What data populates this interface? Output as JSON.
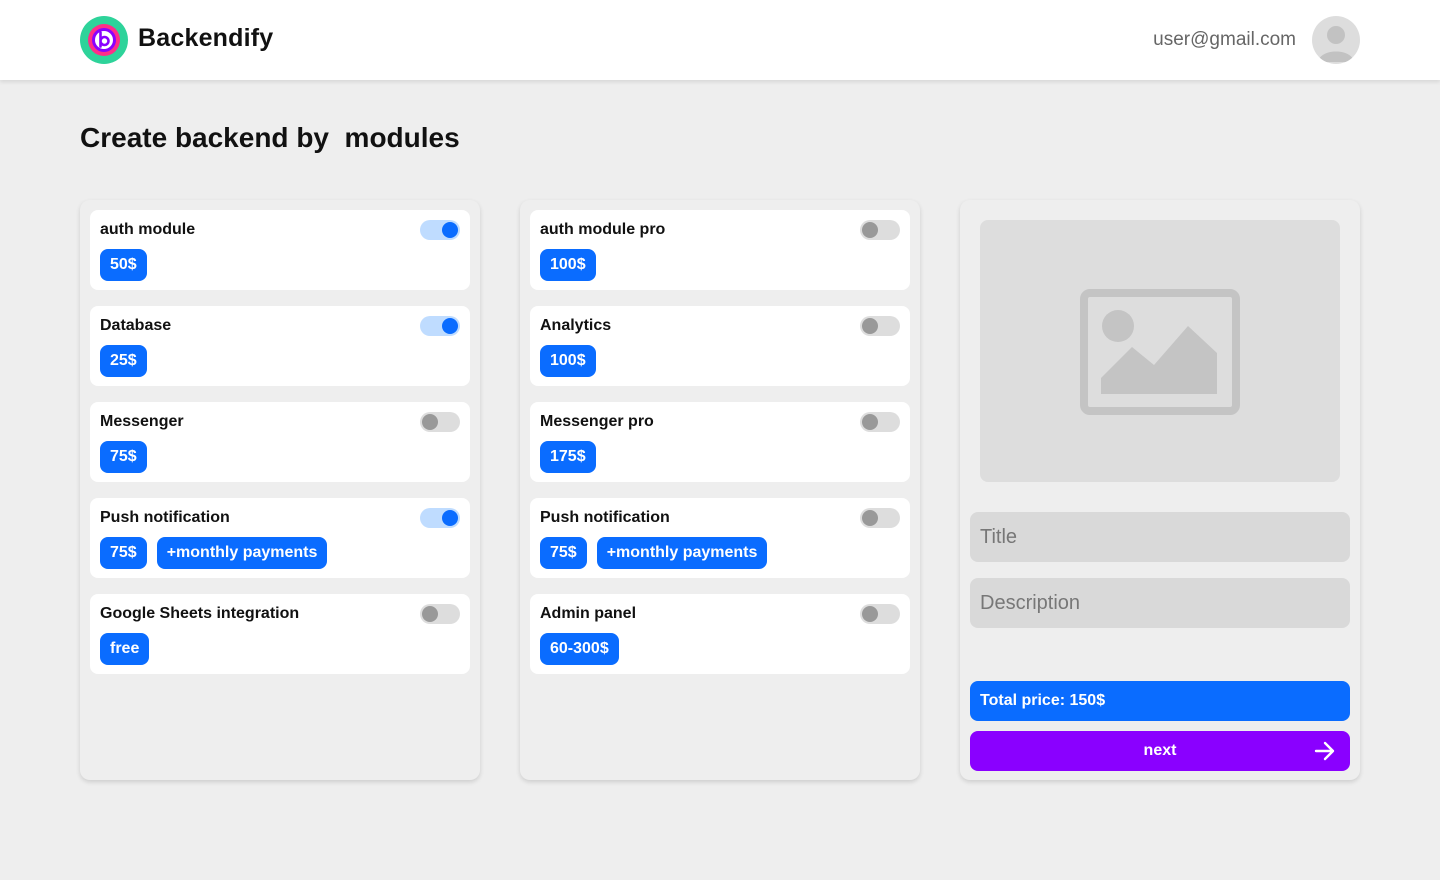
{
  "app": {
    "name": "Backendify",
    "logo_letter": "b"
  },
  "user": {
    "email": "user@gmail.com"
  },
  "page": {
    "title": "Create backend by  modules"
  },
  "columns": [
    {
      "modules": [
        {
          "name": "auth module",
          "enabled": true,
          "tags": [
            "50$"
          ]
        },
        {
          "name": "Database",
          "enabled": true,
          "tags": [
            "25$"
          ]
        },
        {
          "name": "Messenger",
          "enabled": false,
          "tags": [
            "75$"
          ]
        },
        {
          "name": "Push notification",
          "enabled": true,
          "tags": [
            "75$",
            "+monthly payments"
          ]
        },
        {
          "name": "Google Sheets integration",
          "enabled": false,
          "tags": [
            "free"
          ]
        }
      ]
    },
    {
      "modules": [
        {
          "name": "auth module pro",
          "enabled": false,
          "tags": [
            "100$"
          ]
        },
        {
          "name": "Analytics",
          "enabled": false,
          "tags": [
            "100$"
          ]
        },
        {
          "name": "Messenger pro",
          "enabled": false,
          "tags": [
            "175$"
          ]
        },
        {
          "name": "Push notification",
          "enabled": false,
          "tags": [
            "75$",
            "+monthly payments"
          ]
        },
        {
          "name": "Admin panel",
          "enabled": false,
          "tags": [
            "60-300$"
          ]
        }
      ]
    }
  ],
  "summary": {
    "title_placeholder": "Title",
    "description_placeholder": "Description",
    "total_label": "Total price: 150$",
    "next_label": "next"
  },
  "colors": {
    "accent": "#0a6cff",
    "next_button": "#8a00ff",
    "background": "#eeeeee"
  },
  "icons": {
    "logo": "backendify-logo-icon",
    "avatar": "user-avatar-icon",
    "image": "image-placeholder-icon",
    "next": "arrow-right-icon"
  }
}
